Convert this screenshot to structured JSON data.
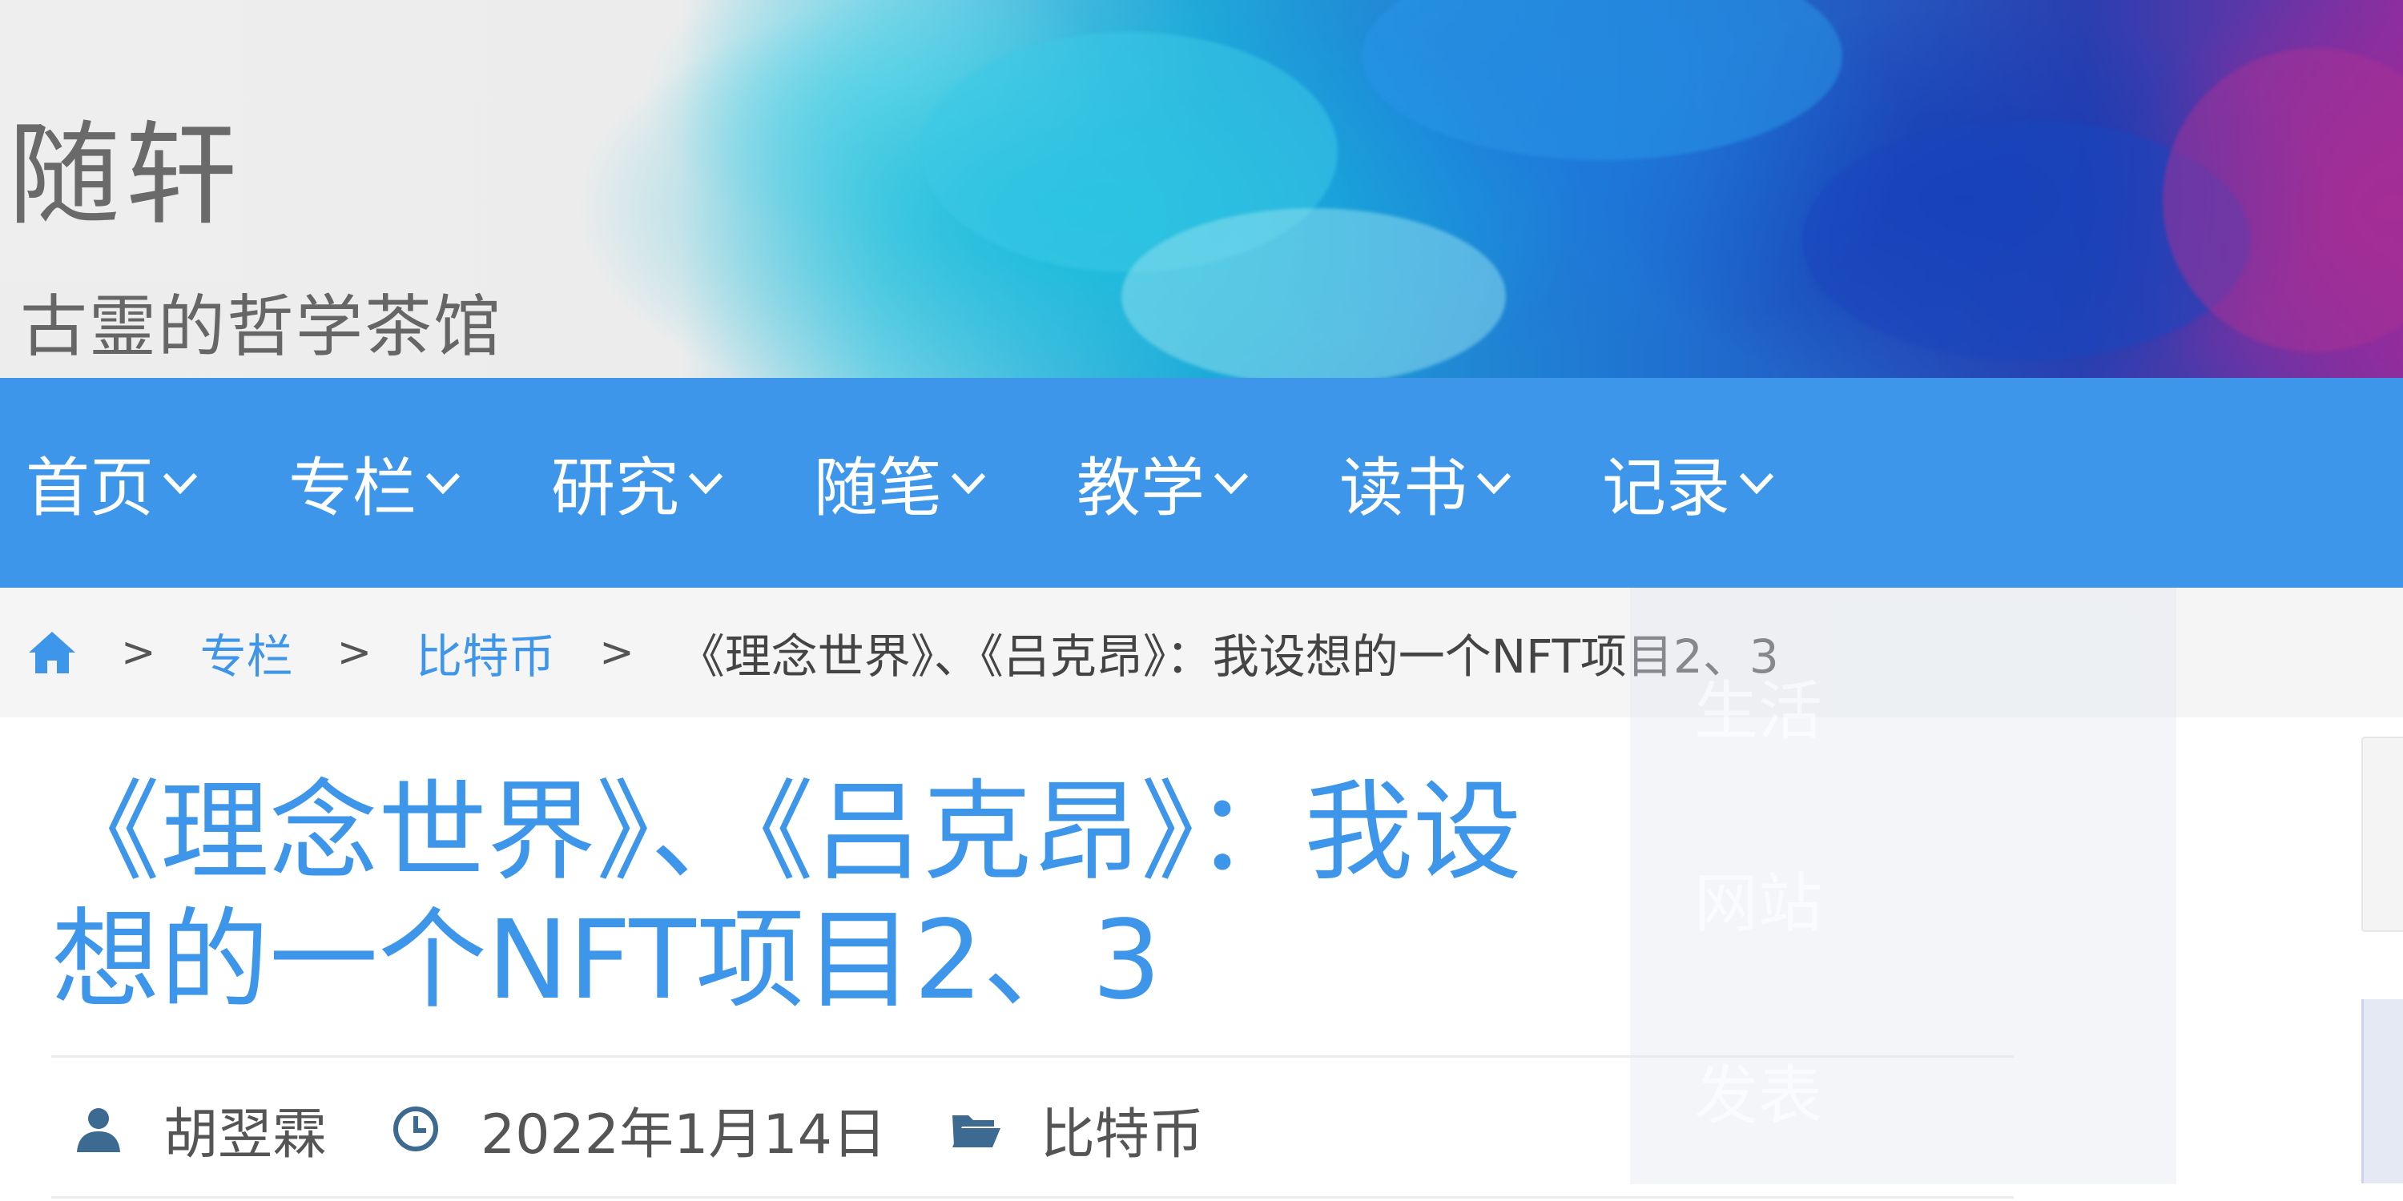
{
  "header": {
    "site_title": "随轩",
    "site_tagline": "古霊的哲学茶馆"
  },
  "nav": {
    "items": [
      {
        "label": "首页",
        "icon": "chevron-down-icon"
      },
      {
        "label": "专栏",
        "icon": "chevron-down-icon"
      },
      {
        "label": "研究",
        "icon": "chevron-down-icon"
      },
      {
        "label": "随笔",
        "icon": "chevron-down-icon"
      },
      {
        "label": "教学",
        "icon": "chevron-down-icon"
      },
      {
        "label": "读书",
        "icon": "chevron-down-icon"
      },
      {
        "label": "记录",
        "icon": "chevron-down-icon"
      }
    ],
    "ghost_dropdown": [
      "生活",
      "网站",
      "发表"
    ]
  },
  "breadcrumb": {
    "home_icon": "home-icon",
    "separator": ">",
    "links": [
      "专栏",
      "比特币"
    ],
    "current": "《理念世界》、《吕克昂》：我设想的一个NFT项目2、3"
  },
  "post": {
    "title_line1": "《理念世界》、《吕克昂》：我设",
    "title_line2": "想的一个NFT项目2、3",
    "author": "胡翌霖",
    "date": "2022年1月14日",
    "category": "比特币",
    "icons": {
      "author": "user-icon",
      "date": "clock-icon",
      "category": "folder-open-icon"
    }
  },
  "colors": {
    "accent": "#3d96ea",
    "nav_bg": "#3d96ea",
    "breadcrumb_bg": "#f5f5f5",
    "text": "#555555"
  }
}
